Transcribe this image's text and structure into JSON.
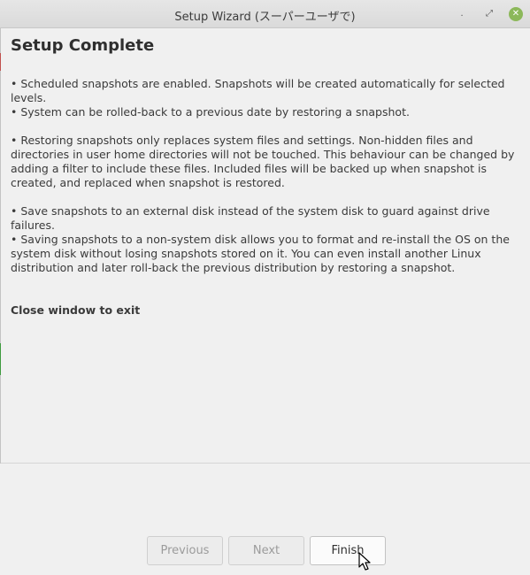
{
  "window": {
    "title": "Setup Wizard (スーパーユーザで)",
    "controls": {
      "minimize_icon": "minimize-icon",
      "maximize_icon": "maximize-icon",
      "close_icon": "close-icon",
      "close_color": "#8cb85a"
    }
  },
  "page": {
    "heading": "Setup Complete",
    "paragraphs": [
      "• Scheduled snapshots are enabled. Snapshots will be created automatically for selected levels.",
      "• System can be rolled-back to a previous date by restoring a snapshot.",
      "• Restoring snapshots only replaces system files and settings. Non-hidden files and directories in user home directories will not be touched. This behaviour can be changed by adding a filter to include these files. Included files will be backed up when snapshot is created, and replaced when snapshot is restored.",
      "• Save snapshots to an external disk instead of the system disk to guard against drive failures.",
      "• Saving snapshots to a non-system disk allows you to format and re-install the OS on the system disk without losing snapshots stored on it. You can even install another Linux distribution and later roll-back the previous distribution by restoring a snapshot."
    ],
    "close_note": "Close window to exit"
  },
  "buttons": {
    "previous": "Previous",
    "next": "Next",
    "finish": "Finish"
  }
}
